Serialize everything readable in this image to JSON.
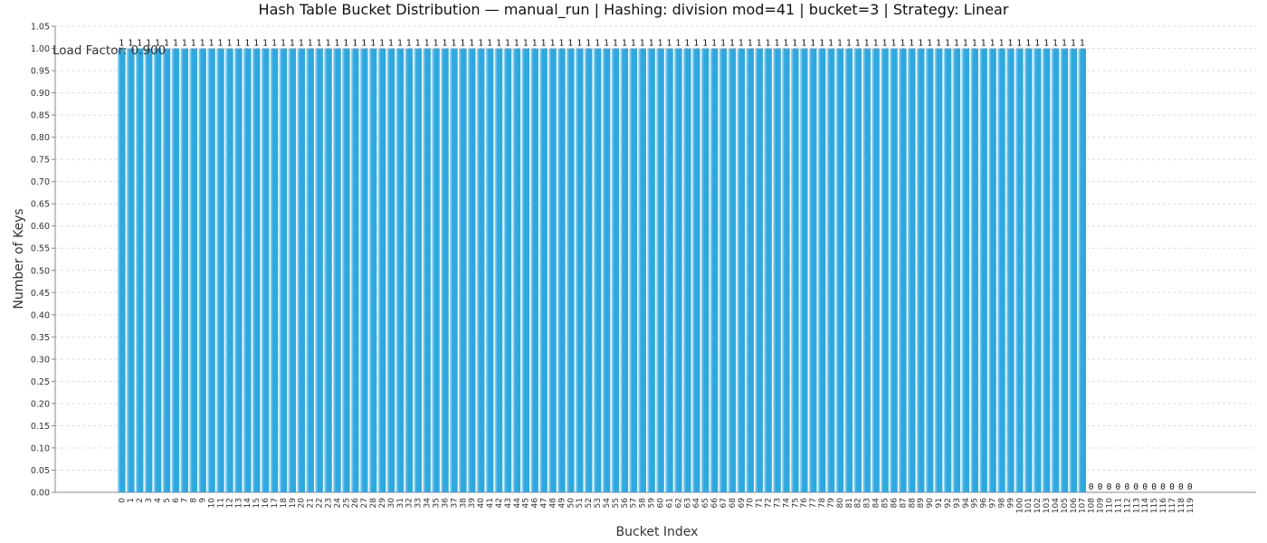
{
  "colors": {
    "bar": "#2fa8e0",
    "bar_highlight": "#a8dcf5",
    "grid": "#dddddd",
    "axis": "#888888"
  },
  "chart_data": {
    "type": "bar",
    "title": "Hash Table Bucket Distribution — manual_run | Hashing: division mod=41 | bucket=3 | Strategy: Linear",
    "xlabel": "Bucket Index",
    "ylabel": "Number of Keys",
    "ylim": [
      0,
      1.05
    ],
    "yticks": [
      "0.00",
      "0.05",
      "0.10",
      "0.15",
      "0.20",
      "0.25",
      "0.30",
      "0.35",
      "0.40",
      "0.45",
      "0.50",
      "0.55",
      "0.60",
      "0.65",
      "0.70",
      "0.75",
      "0.80",
      "0.85",
      "0.90",
      "0.95",
      "1.00",
      "1.05"
    ],
    "annotation": "Load Factor: 0.900",
    "categories": [
      "0",
      "1",
      "2",
      "3",
      "4",
      "5",
      "6",
      "7",
      "8",
      "9",
      "10",
      "11",
      "12",
      "13",
      "14",
      "15",
      "16",
      "17",
      "18",
      "19",
      "20",
      "21",
      "22",
      "23",
      "24",
      "25",
      "26",
      "27",
      "28",
      "29",
      "30",
      "31",
      "32",
      "33",
      "34",
      "35",
      "36",
      "37",
      "38",
      "39",
      "40",
      "41",
      "42",
      "43",
      "44",
      "45",
      "46",
      "47",
      "48",
      "49",
      "50",
      "51",
      "52",
      "53",
      "54",
      "55",
      "56",
      "57",
      "58",
      "59",
      "60",
      "61",
      "62",
      "63",
      "64",
      "65",
      "66",
      "67",
      "68",
      "69",
      "70",
      "71",
      "72",
      "73",
      "74",
      "75",
      "76",
      "77",
      "78",
      "79",
      "80",
      "81",
      "82",
      "83",
      "84",
      "85",
      "86",
      "87",
      "88",
      "89",
      "90",
      "91",
      "92",
      "93",
      "94",
      "95",
      "96",
      "97",
      "98",
      "99",
      "100",
      "101",
      "102",
      "103",
      "104",
      "105",
      "106",
      "107",
      "108",
      "109",
      "110",
      "111",
      "112",
      "113",
      "114",
      "115",
      "116",
      "117",
      "118",
      "119"
    ],
    "values": [
      1,
      1,
      1,
      1,
      1,
      1,
      1,
      1,
      1,
      1,
      1,
      1,
      1,
      1,
      1,
      1,
      1,
      1,
      1,
      1,
      1,
      1,
      1,
      1,
      1,
      1,
      1,
      1,
      1,
      1,
      1,
      1,
      1,
      1,
      1,
      1,
      1,
      1,
      1,
      1,
      1,
      1,
      1,
      1,
      1,
      1,
      1,
      1,
      1,
      1,
      1,
      1,
      1,
      1,
      1,
      1,
      1,
      1,
      1,
      1,
      1,
      1,
      1,
      1,
      1,
      1,
      1,
      1,
      1,
      1,
      1,
      1,
      1,
      1,
      1,
      1,
      1,
      1,
      1,
      1,
      1,
      1,
      1,
      1,
      1,
      1,
      1,
      1,
      1,
      1,
      1,
      1,
      1,
      1,
      1,
      1,
      1,
      1,
      1,
      1,
      1,
      1,
      1,
      1,
      1,
      1,
      1,
      1,
      0,
      0,
      0,
      0,
      0,
      0,
      0,
      0,
      0,
      0,
      0,
      0
    ],
    "value_labels": [
      "1",
      "1",
      "1",
      "1",
      "1",
      "1",
      "1",
      "1",
      "1",
      "1",
      "1",
      "1",
      "1",
      "1",
      "1",
      "1",
      "1",
      "1",
      "1",
      "1",
      "1",
      "1",
      "1",
      "1",
      "1",
      "1",
      "1",
      "1",
      "1",
      "1",
      "1",
      "1",
      "1",
      "1",
      "1",
      "1",
      "1",
      "1",
      "1",
      "1",
      "1",
      "1",
      "1",
      "1",
      "1",
      "1",
      "1",
      "1",
      "1",
      "1",
      "1",
      "1",
      "1",
      "1",
      "1",
      "1",
      "1",
      "1",
      "1",
      "1",
      "1",
      "1",
      "1",
      "1",
      "1",
      "1",
      "1",
      "1",
      "1",
      "1",
      "1",
      "1",
      "1",
      "1",
      "1",
      "1",
      "1",
      "1",
      "1",
      "1",
      "1",
      "1",
      "1",
      "1",
      "1",
      "1",
      "1",
      "1",
      "1",
      "1",
      "1",
      "1",
      "1",
      "1",
      "1",
      "1",
      "1",
      "1",
      "1",
      "1",
      "1",
      "1",
      "1",
      "1",
      "1",
      "1",
      "1",
      "1",
      "0",
      "0",
      "0",
      "0",
      "0",
      "0",
      "0",
      "0",
      "0",
      "0",
      "0",
      "0"
    ],
    "grid": true,
    "legend": "none"
  }
}
